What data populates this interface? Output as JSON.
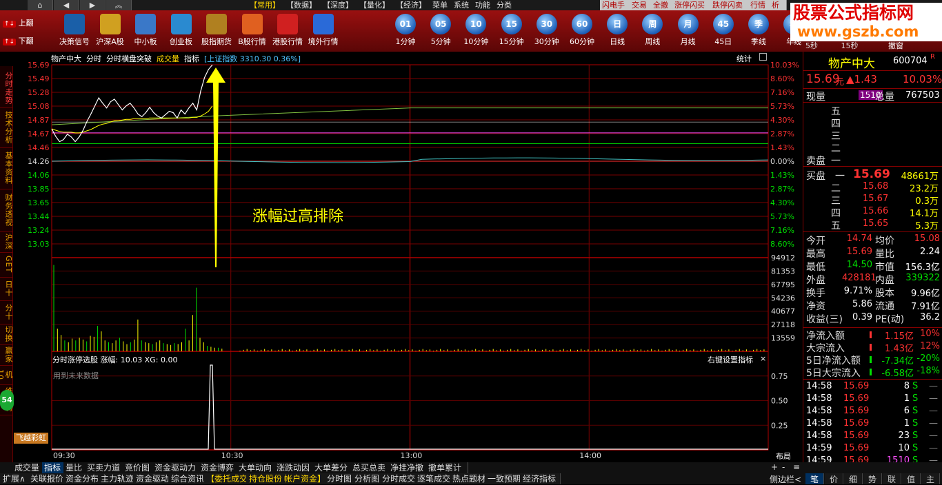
{
  "top": {
    "nav_home": "⌂",
    "nav_back": "◀",
    "nav_fwd": "▶",
    "nav_up": "︽",
    "menus": [
      "【常用】",
      "【数据】",
      "【深度】",
      "【量化】",
      "【经济】",
      "菜单",
      "系统",
      "功能",
      "分类"
    ],
    "active_menu_index": 0,
    "tabs": [
      "闪电手",
      "交易",
      "全撤",
      "涨停闪买",
      "跌停闪卖",
      "行情",
      "析"
    ]
  },
  "watermark": {
    "line1": "股票公式指标网",
    "line2": "www.gszb.com"
  },
  "toolbar": {
    "page_up": "上翻",
    "page_down": "下翻",
    "items": [
      {
        "label": "决策信号",
        "icon": "decision-signal-icon"
      },
      {
        "label": "沪深A股",
        "icon": "a-share-icon"
      },
      {
        "label": "中小板",
        "icon": "sme-board-icon"
      },
      {
        "label": "创业板",
        "icon": "gem-board-icon"
      },
      {
        "label": "股指期货",
        "icon": "futures-icon"
      },
      {
        "label": "B股行情",
        "icon": "b-share-icon"
      },
      {
        "label": "港股行情",
        "icon": "hk-stock-icon"
      },
      {
        "label": "境外行情",
        "icon": "overseas-icon"
      }
    ],
    "periods": [
      {
        "badge": "01",
        "label": "1分钟"
      },
      {
        "badge": "05",
        "label": "5分钟"
      },
      {
        "badge": "10",
        "label": "10分钟"
      },
      {
        "badge": "15",
        "label": "15分钟"
      },
      {
        "badge": "30",
        "label": "30分钟"
      },
      {
        "badge": "60",
        "label": "60分钟"
      },
      {
        "badge": "日",
        "label": "日线"
      },
      {
        "badge": "周",
        "label": "周线"
      },
      {
        "badge": "月",
        "label": "月线"
      },
      {
        "badge": "45",
        "label": "45日"
      },
      {
        "badge": "季",
        "label": "季线"
      },
      {
        "badge": "年",
        "label": "年线"
      }
    ],
    "right_small": [
      "5秒",
      "15秒",
      "撤窗"
    ]
  },
  "left_tabs": [
    "分时走势",
    "技术分析",
    "基本资料",
    "财务透视",
    "沪深",
    "GET",
    "日十",
    "分十",
    "切换",
    "赢家",
    "机10",
    "维赛特10"
  ],
  "left_badge": "54",
  "chart": {
    "stock_name": "物产中大",
    "header_items": [
      "分时",
      "分时横盘突破",
      "成交量",
      "指标"
    ],
    "index_label": "[上证指数",
    "index_value": "3310.30 0.36%]",
    "stats_label": "统计",
    "price_ticks": [
      "15.69",
      "15.49",
      "15.28",
      "15.08",
      "14.87",
      "14.67",
      "14.46",
      "14.26",
      "14.06",
      "13.85",
      "13.65",
      "13.44",
      "13.24",
      "13.03"
    ],
    "pct_ticks": [
      "10.03%",
      "8.60%",
      "7.16%",
      "5.73%",
      "4.30%",
      "2.87%",
      "1.43%",
      "0.00%",
      "1.43%",
      "2.87%",
      "4.30%",
      "5.73%",
      "7.16%",
      "8.60%"
    ],
    "vol_ticks": [
      "94912",
      "81353",
      "67795",
      "54236",
      "40677",
      "27118",
      "13559"
    ],
    "annotation": "涨幅过高排除",
    "indicator_header": "分时涨停选股  涨幅: 10.03  XG: 0.00",
    "indicator_right": "右键设置指标",
    "indicator_close": "×",
    "future_note": "用到未来数据",
    "ind_ticks": [
      "0.75",
      "0.50",
      "0.25"
    ],
    "time_ticks": [
      "09:30",
      "10:30",
      "13:00",
      "14:00"
    ],
    "layout_label": "布局",
    "logo_text": "飞越彩虹",
    "price_series": [
      14.74,
      14.63,
      14.55,
      14.58,
      14.66,
      14.62,
      14.55,
      14.62,
      14.72,
      14.85,
      14.96,
      15.08,
      15.2,
      15.12,
      15.05,
      15.14,
      15.18,
      15.1,
      15.02,
      15.08,
      15.12,
      15.05,
      14.96,
      14.92,
      14.98,
      15.06,
      14.98,
      14.93,
      14.9,
      14.95,
      15.0,
      14.98,
      14.9,
      15.02,
      14.96,
      15.05,
      15.12,
      15.02,
      15.3,
      15.5,
      15.62,
      15.69
    ],
    "avg_series": [
      14.74,
      14.72,
      14.7,
      14.69,
      14.69,
      14.69,
      14.68,
      14.68,
      14.69,
      14.71,
      14.73,
      14.76,
      14.79,
      14.81,
      14.82,
      14.84,
      14.86,
      14.86,
      14.87,
      14.88,
      14.88,
      14.89,
      14.89,
      14.89,
      14.89,
      14.9,
      14.9,
      14.9,
      14.9,
      14.9,
      14.9,
      14.9,
      14.9,
      14.9,
      14.9,
      14.9,
      14.91,
      14.91,
      14.93,
      14.96,
      15.0,
      15.08
    ]
  },
  "right": {
    "name": "物产中大",
    "code": "600704",
    "flag": "R",
    "price": "15.69",
    "unit": "元",
    "change": "▲1.43",
    "change_pct": "10.03%",
    "now_vol_label": "现量",
    "now_vol": "1510",
    "total_vol_label": "总量",
    "total_vol": "767503",
    "sell_levels": [
      "五",
      "四",
      "三",
      "二",
      "一"
    ],
    "sell_label": "卖盘",
    "buy_label": "买盘",
    "buy_levels": [
      {
        "lvl": "一",
        "price": "15.69",
        "vol": "48661万"
      },
      {
        "lvl": "二",
        "price": "15.68",
        "vol": "23.2万"
      },
      {
        "lvl": "三",
        "price": "15.67",
        "vol": "0.3万"
      },
      {
        "lvl": "四",
        "price": "15.66",
        "vol": "14.1万"
      },
      {
        "lvl": "五",
        "price": "15.65",
        "vol": "5.3万"
      }
    ],
    "stats": [
      {
        "l1": "今开",
        "v1": "14.74",
        "l2": "均价",
        "v2": "15.08"
      },
      {
        "l1": "最高",
        "v1": "15.69",
        "l2": "量比",
        "v2": "2.24"
      },
      {
        "l1": "最低",
        "v1": "14.50",
        "l2": "市值",
        "v2": "156.3亿"
      },
      {
        "l1": "外盘",
        "v1": "428181",
        "l2": "内盘",
        "v2": "339322"
      },
      {
        "l1": "换手",
        "v1": "9.71%",
        "l2": "股本",
        "v2": "9.96亿"
      },
      {
        "l1": "净资",
        "v1": "5.86",
        "l2": "流通",
        "v2": "7.91亿"
      },
      {
        "l1": "收益(三)",
        "v1": "0.39",
        "l2": "PE(动)",
        "v2": "36.2"
      }
    ],
    "flows": [
      {
        "label": "净流入额",
        "value": "1.15亿",
        "pct": "10%",
        "color": "red"
      },
      {
        "label": "大宗流入",
        "value": "1.43亿",
        "pct": "12%",
        "color": "red"
      },
      {
        "label": "5日净流入额",
        "value": "-7.34亿",
        "pct": "-20%",
        "color": "grn"
      },
      {
        "label": "5日大宗流入",
        "value": "-6.58亿",
        "pct": "-18%",
        "color": "grn"
      }
    ],
    "ticks": [
      {
        "t": "14:58",
        "p": "15.69",
        "v": "8",
        "s": "S"
      },
      {
        "t": "14:58",
        "p": "15.69",
        "v": "1",
        "s": "S"
      },
      {
        "t": "14:58",
        "p": "15.69",
        "v": "6",
        "s": "S"
      },
      {
        "t": "14:58",
        "p": "15.69",
        "v": "1",
        "s": "S"
      },
      {
        "t": "14:58",
        "p": "15.69",
        "v": "23",
        "s": "S"
      },
      {
        "t": "14:59",
        "p": "15.69",
        "v": "10",
        "s": "S"
      },
      {
        "t": "14:59",
        "p": "15.69",
        "v": "1510",
        "s": "S"
      }
    ],
    "dash": "—"
  },
  "bottom": {
    "tabs1": [
      "成交量",
      "指标",
      "量比",
      "买卖力道",
      "竞价图",
      "资金驱动力",
      "资金博弈",
      "大单动向",
      "涨跌动因",
      "大单差分",
      "总买总卖",
      "净挂净撤",
      "撤单累计"
    ],
    "active1": 1,
    "tabs2": [
      "扩展∧",
      "关联报价",
      "资金分布",
      "主力轨迹",
      "资金驱动",
      "综合资讯",
      "【委托成交",
      "持仓股份",
      "帐户资金】",
      "分时图",
      "分析图",
      "分时成交",
      "逐笔成交",
      "热点题材",
      "一致预期",
      "经济指标"
    ],
    "right1": [
      "+",
      "-",
      "≡"
    ],
    "right2": "侧边栏<",
    "right_tabs": [
      "笔",
      "价",
      "细",
      "势",
      "联",
      "值",
      "主"
    ]
  },
  "colors": {
    "accent_red": "#ff3232",
    "grid_red": "#8b0000",
    "price_line": "#ffffff",
    "avg_line": "#ffff00"
  }
}
